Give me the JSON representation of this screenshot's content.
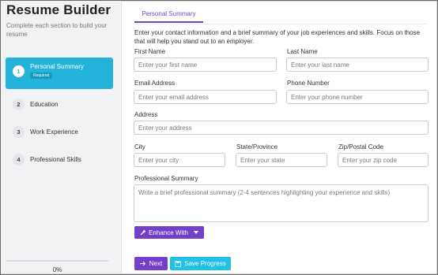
{
  "sidebar": {
    "title": "Resume Builder",
    "subtitle": "Complete each section to build your resume",
    "steps": [
      {
        "num": "1",
        "label": "Personal Summary",
        "badge": "Required"
      },
      {
        "num": "2",
        "label": "Education"
      },
      {
        "num": "3",
        "label": "Work Experience"
      },
      {
        "num": "4",
        "label": "Professional Skills"
      }
    ],
    "progress": {
      "value": 0,
      "label": "0%"
    }
  },
  "main": {
    "tab": "Personal Summary",
    "intro": "Enter your contact information and a brief summary of your job experiences and skills. Focus on those that will help you stand out to an employer.",
    "fields": {
      "first_name": {
        "label": "First Name",
        "placeholder": "Enter your first name"
      },
      "last_name": {
        "label": "Last Name",
        "placeholder": "Enter your last name"
      },
      "email": {
        "label": "Email Address",
        "placeholder": "Enter your email address"
      },
      "phone": {
        "label": "Phone Number",
        "placeholder": "Enter your phone number"
      },
      "address": {
        "label": "Address",
        "placeholder": "Enter your address"
      },
      "city": {
        "label": "City",
        "placeholder": "Enter your city"
      },
      "state": {
        "label": "State/Province",
        "placeholder": "Enter your state"
      },
      "zip": {
        "label": "Zip/Postal Code",
        "placeholder": "Enter your zip code"
      },
      "summary": {
        "label": "Professional Summary",
        "placeholder": "Write a brief professional summary (2-4 sentences highlighting your experience and skills)"
      }
    },
    "enhance_label": "Enhance With",
    "next_label": "Next",
    "save_label": "Save Progress"
  },
  "colors": {
    "accent": "#7340c9",
    "active_step": "#23b3da",
    "save": "#1fc1e6"
  }
}
